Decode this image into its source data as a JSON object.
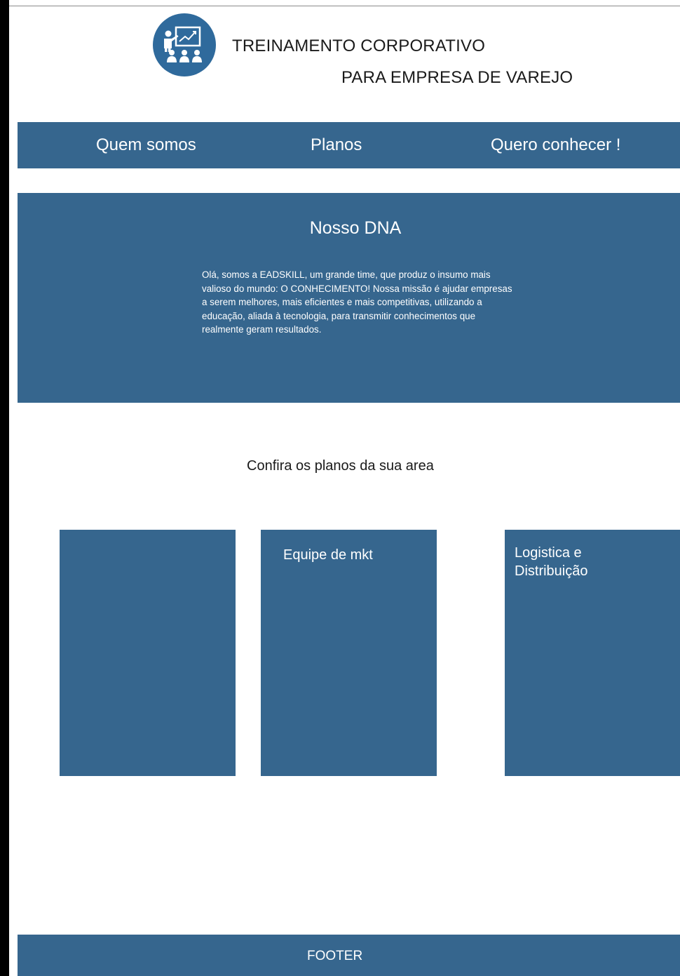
{
  "header": {
    "logo_icon": "training-presentation-icon",
    "title_line1": "TREINAMENTO CORPORATIVO",
    "title_line2": "PARA EMPRESA DE VAREJO"
  },
  "nav": {
    "items": [
      {
        "label": "Quem somos"
      },
      {
        "label": "Planos"
      },
      {
        "label": "Quero conhecer !"
      }
    ]
  },
  "dna": {
    "title": "Nosso DNA",
    "text": "Olá, somos a EADSKILL, um grande time, que produz o insumo mais valioso do mundo: O CONHECIMENTO! Nossa missão é ajudar empresas a serem melhores, mais eficientes e mais competitivas, utilizando a educação, aliada à tecnologia, para transmitir conhecimentos que realmente geram resultados."
  },
  "plans": {
    "heading": "Confira os planos da sua area",
    "cards": [
      {
        "label": ""
      },
      {
        "label": "Equipe de mkt"
      },
      {
        "label": "Logistica e Distribuição"
      }
    ]
  },
  "footer": {
    "label": "FOOTER"
  },
  "colors": {
    "primary": "#36668e",
    "logo": "#2f6a9c",
    "background": "#ffffff",
    "text_dark": "#1a1a1a"
  }
}
